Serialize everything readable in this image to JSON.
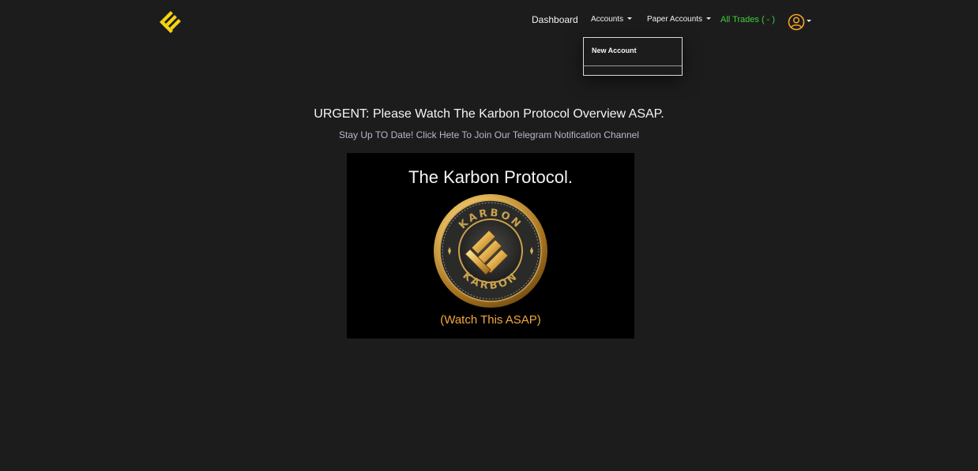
{
  "nav": {
    "dashboard": "Dashboard",
    "accounts": "Accounts",
    "paper_accounts": "Paper Accounts",
    "all_trades": "All Trades ( - )"
  },
  "dropdown": {
    "items": [
      "New Account"
    ]
  },
  "main": {
    "headline": "URGENT: Please Watch The Karbon Protocol Overview ASAP.",
    "telegram_link": "Stay Up TO Date! Click Hete To Join Our Telegram Notification Channel"
  },
  "video": {
    "title": "The Karbon Protocol.",
    "coin_text_top": "KARBON",
    "coin_text_bottom": "KARBON",
    "cta": "(Watch This ASAP)"
  },
  "colors": {
    "background": "#1c1c1d",
    "accent_yellow": "#f5d312",
    "trades_green": "#3fd13a",
    "cta_orange": "#f2a93b",
    "link_gray": "#b6b9c6"
  },
  "icons": {
    "logo": "karbon-logo-icon",
    "user": "user-circle-icon"
  }
}
